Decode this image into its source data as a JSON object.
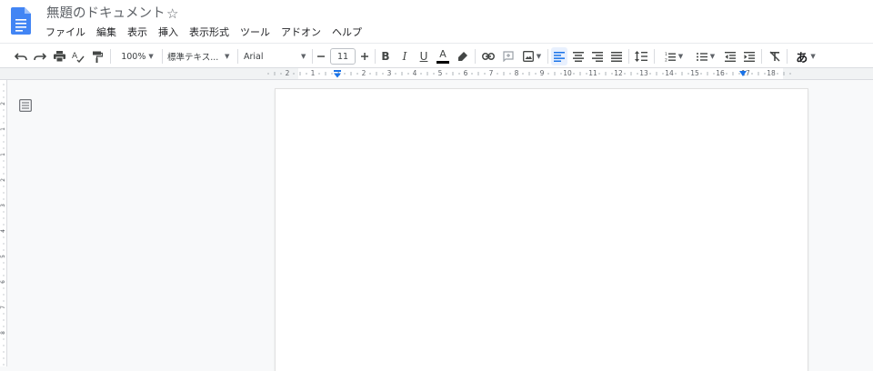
{
  "title": "無題のドキュメント",
  "menu": [
    "ファイル",
    "編集",
    "表示",
    "挿入",
    "表示形式",
    "ツール",
    "アドオン",
    "ヘルプ"
  ],
  "toolbar": {
    "zoom": "100%",
    "style": "標準テキス...",
    "font": "Arial",
    "font_size": "11",
    "input_tool": "あ"
  },
  "ruler": {
    "labels": [
      "2",
      "1",
      "1",
      "2",
      "3",
      "4",
      "5",
      "6",
      "7",
      "8",
      "9",
      "10",
      "11",
      "12",
      "13",
      "14",
      "15",
      "16",
      "17",
      "18"
    ]
  },
  "vertical_ruler": {
    "labels": [
      "2",
      "1",
      "1",
      "2",
      "3",
      "4",
      "5",
      "6",
      "7",
      "8"
    ]
  },
  "colors": {
    "accent": "#1a73e8",
    "icon": "#444746",
    "page_bg": "#f8f9fa",
    "text_color_underline": "#000000"
  },
  "icons": [
    "docs-logo-icon",
    "star-icon",
    "undo-icon",
    "redo-icon",
    "print-icon",
    "spellcheck-icon",
    "paint-format-icon",
    "minus-icon",
    "plus-icon",
    "bold-icon",
    "italic-icon",
    "underline-icon",
    "text-color-icon",
    "highlight-icon",
    "link-icon",
    "comment-icon",
    "image-icon",
    "align-left-icon",
    "align-center-icon",
    "align-right-icon",
    "justify-icon",
    "line-spacing-icon",
    "numbered-list-icon",
    "bulleted-list-icon",
    "decrease-indent-icon",
    "increase-indent-icon",
    "clear-formatting-icon",
    "outline-icon"
  ]
}
